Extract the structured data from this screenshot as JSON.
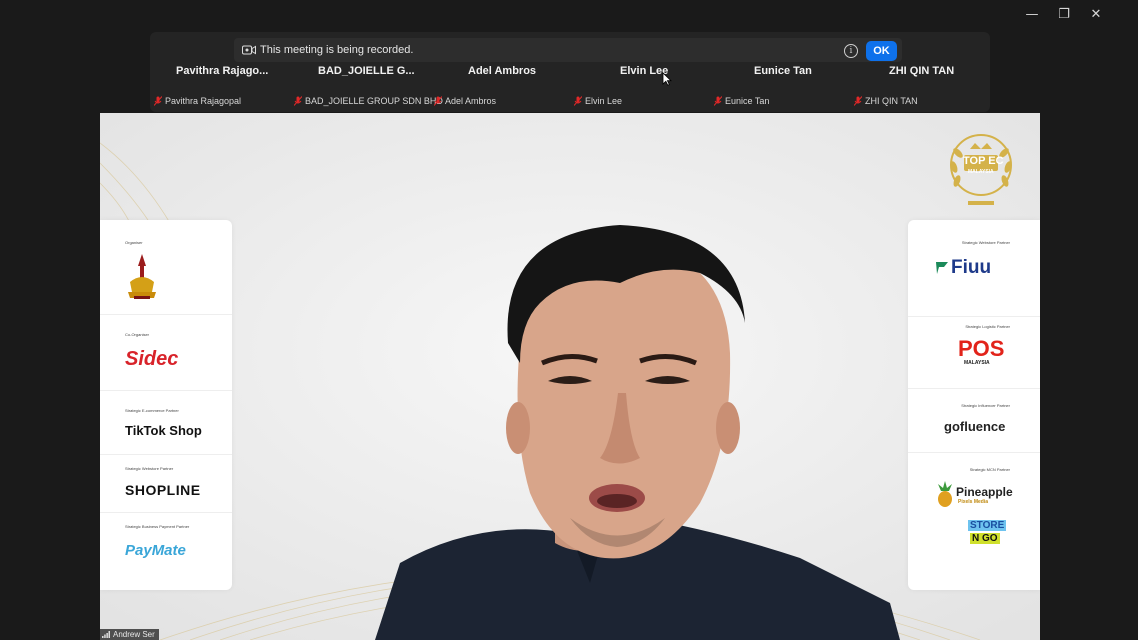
{
  "window": {
    "controls": {
      "minimize": "—",
      "restore": "❐",
      "close": "✕"
    }
  },
  "recording": {
    "text": "This meeting is being recorded.",
    "ok_label": "OK",
    "info_symbol": "i"
  },
  "participants_names": [
    "Pavithra  Rajago...",
    "BAD_JOIELLE G...",
    "Adel Ambros",
    "Elvin Lee",
    "Eunice Tan",
    "ZHI QIN TAN"
  ],
  "participant_tiles": [
    "Pavithra Rajagopal",
    "BAD_JOIELLE GROUP SDN BHD",
    "Adel Ambros",
    "Elvin Lee",
    "Eunice Tan",
    "ZHI QIN TAN"
  ],
  "speaker": {
    "name": "Andrew Ser"
  },
  "backdrop": {
    "award": {
      "line1": "TOP EC",
      "line2": "MALAYSIA"
    },
    "left_partners": [
      {
        "caption": "Organiser",
        "logo": ""
      },
      {
        "caption": "Co-Organiser",
        "logo": "Sidec"
      },
      {
        "caption": "Strategic E-commerce Partner",
        "logo": "TikTok Shop"
      },
      {
        "caption": "Strategic Webstore Partner",
        "logo": "SHOPLINE"
      },
      {
        "caption": "Strategic Business Payment Partner",
        "logo": "PayMate"
      }
    ],
    "right_partners": [
      {
        "caption": "Strategic Webstore Partner",
        "logo": "Fiuu"
      },
      {
        "caption": "Strategic Logistic Partner",
        "logo": "POS",
        "sub": "MALAYSIA"
      },
      {
        "caption": "Strategic Influencer Partner",
        "logo": "gofluence"
      },
      {
        "caption": "Strategic MCN Partner",
        "logo": "Pineapple",
        "sub": "Pixels Media"
      },
      {
        "caption": "",
        "logo": "STORE",
        "sub": "N GO"
      }
    ]
  },
  "colors": {
    "accent_blue": "#0e71eb",
    "muted_red": "#e02828",
    "panel": "#242424",
    "gold": "#c9a227"
  }
}
